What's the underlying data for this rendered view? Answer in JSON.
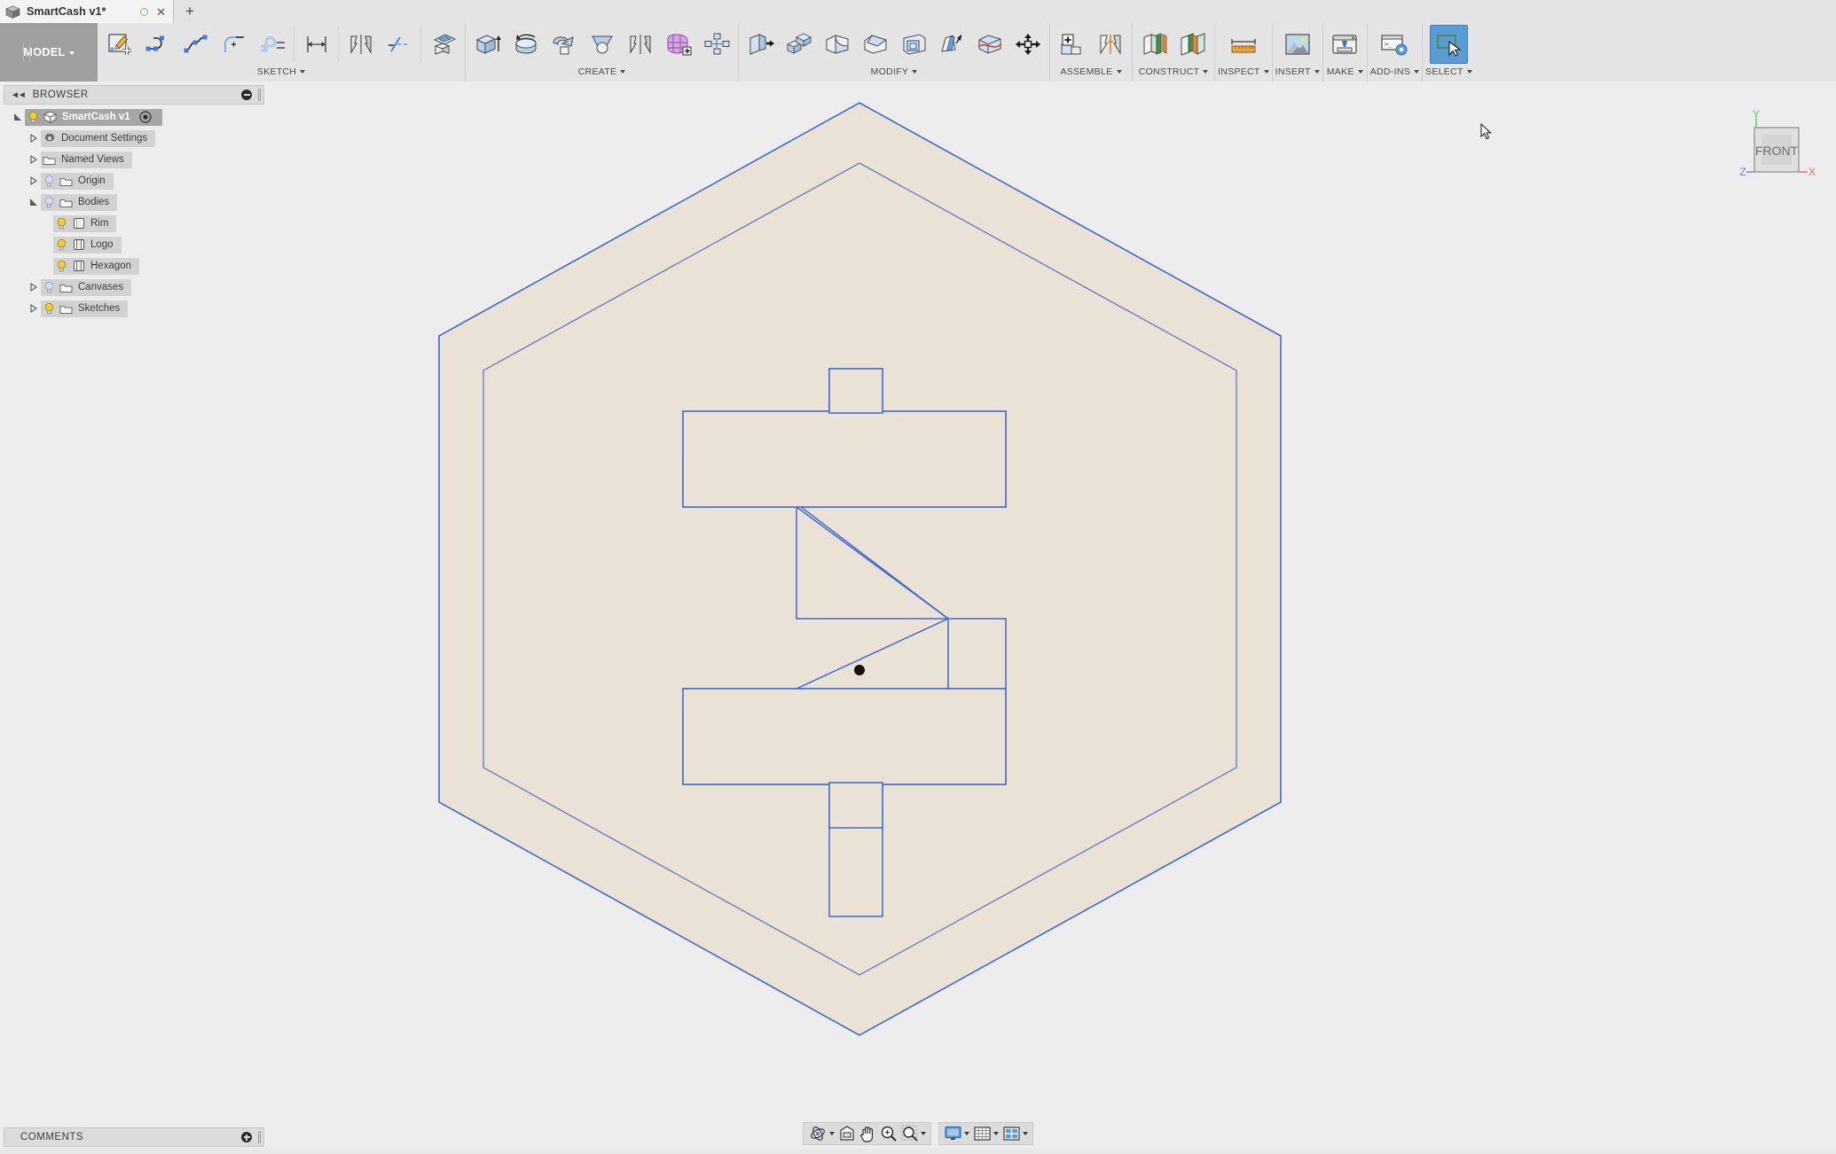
{
  "window": {
    "tab_title": "SmartCash v1*",
    "cube_icon": "cube-icon",
    "unsaved_dot": "unsaved-indicator",
    "close_icon": "close-icon",
    "new_tab_icon": "plus-icon"
  },
  "ribbon": {
    "workspace": {
      "label": "MODEL",
      "icon": "chevron-down-icon"
    },
    "groups": [
      {
        "label": "SKETCH",
        "icons": [
          "create-sketch-icon",
          "line-icon",
          "spline-icon",
          "fillet-sketch-icon",
          "offset-icon",
          "dimension-icon",
          "mirror-sketch-icon",
          "trim-icon",
          "project-icon"
        ]
      },
      {
        "label": "CREATE",
        "icons": [
          "extrude-icon",
          "revolve-icon",
          "sweep-icon",
          "loft-icon",
          "mirror-icon",
          "create-form-icon",
          "pattern-icon"
        ]
      },
      {
        "label": "MODIFY",
        "icons": [
          "press-pull-icon",
          "combine-icon",
          "fillet-icon",
          "chamfer-icon",
          "shell-icon",
          "draft-icon",
          "split-body-icon",
          "move-copy-icon"
        ]
      },
      {
        "label": "ASSEMBLE",
        "icons": [
          "new-component-icon",
          "joint-icon"
        ]
      },
      {
        "label": "CONSTRUCT",
        "icons": [
          "offset-plane-icon",
          "plane-at-angle-icon"
        ]
      },
      {
        "label": "INSPECT",
        "icons": [
          "measure-icon"
        ]
      },
      {
        "label": "INSERT",
        "icons": [
          "insert-canvas-icon"
        ]
      },
      {
        "label": "MAKE",
        "icons": [
          "3d-print-icon"
        ]
      },
      {
        "label": "ADD-INS",
        "icons": [
          "scripts-addins-icon"
        ]
      },
      {
        "label": "SELECT",
        "icons": [
          "select-tool-icon"
        ],
        "active": true
      }
    ]
  },
  "browser": {
    "panel_title": "BROWSER",
    "collapse_icon": "collapse-left-icon",
    "minimize_icon": "minimize-icon",
    "tree": [
      {
        "label": "SmartCash v1",
        "depth": 0,
        "twist": "expanded",
        "icon": "component-icon",
        "bulb": "on",
        "selected": true,
        "dot": true
      },
      {
        "label": "Document Settings",
        "depth": 1,
        "twist": "collapsed",
        "icon": "gear-icon",
        "bulb": "none"
      },
      {
        "label": "Named Views",
        "depth": 1,
        "twist": "collapsed",
        "icon": "folder-icon",
        "bulb": "none"
      },
      {
        "label": "Origin",
        "depth": 1,
        "twist": "collapsed",
        "icon": "folder-icon",
        "bulb": "off"
      },
      {
        "label": "Bodies",
        "depth": 1,
        "twist": "expanded",
        "icon": "folder-icon",
        "bulb": "off"
      },
      {
        "label": "Rim",
        "depth": 2,
        "twist": "none",
        "icon": "body-icon",
        "bulb": "on"
      },
      {
        "label": "Logo",
        "depth": 2,
        "twist": "none",
        "icon": "body-icon",
        "bulb": "on"
      },
      {
        "label": "Hexagon",
        "depth": 2,
        "twist": "none",
        "icon": "body-icon",
        "bulb": "on"
      },
      {
        "label": "Canvases",
        "depth": 1,
        "twist": "collapsed",
        "icon": "folder-icon",
        "bulb": "off"
      },
      {
        "label": "Sketches",
        "depth": 1,
        "twist": "collapsed",
        "icon": "folder-icon",
        "bulb": "on"
      }
    ]
  },
  "viewcube": {
    "face_label": "FRONT",
    "axes": [
      {
        "label": "Y",
        "color": "#4cd34c"
      },
      {
        "label": "X",
        "color": "#f06a6a"
      },
      {
        "label": "Z",
        "color": "#6a7ef0"
      }
    ]
  },
  "canvas": {
    "background": "#ededed",
    "body_fill": "#ebe2d6",
    "edge_color": "#3a6bd4",
    "origin_point": "origin-point"
  },
  "comments": {
    "panel_title": "COMMENTS",
    "add_icon": "add-comment-icon"
  },
  "navbar": {
    "buttons": [
      {
        "icon": "orbit-icon",
        "menu": true
      },
      {
        "icon": "look-at-icon",
        "menu": false
      },
      {
        "icon": "pan-icon",
        "menu": false
      },
      {
        "icon": "zoom-icon",
        "menu": false
      },
      {
        "icon": "fit-icon",
        "menu": true
      }
    ],
    "display_buttons": [
      {
        "icon": "display-settings-icon",
        "menu": true
      },
      {
        "icon": "grid-settings-icon",
        "menu": true
      },
      {
        "icon": "viewport-layout-icon",
        "menu": true
      }
    ]
  }
}
